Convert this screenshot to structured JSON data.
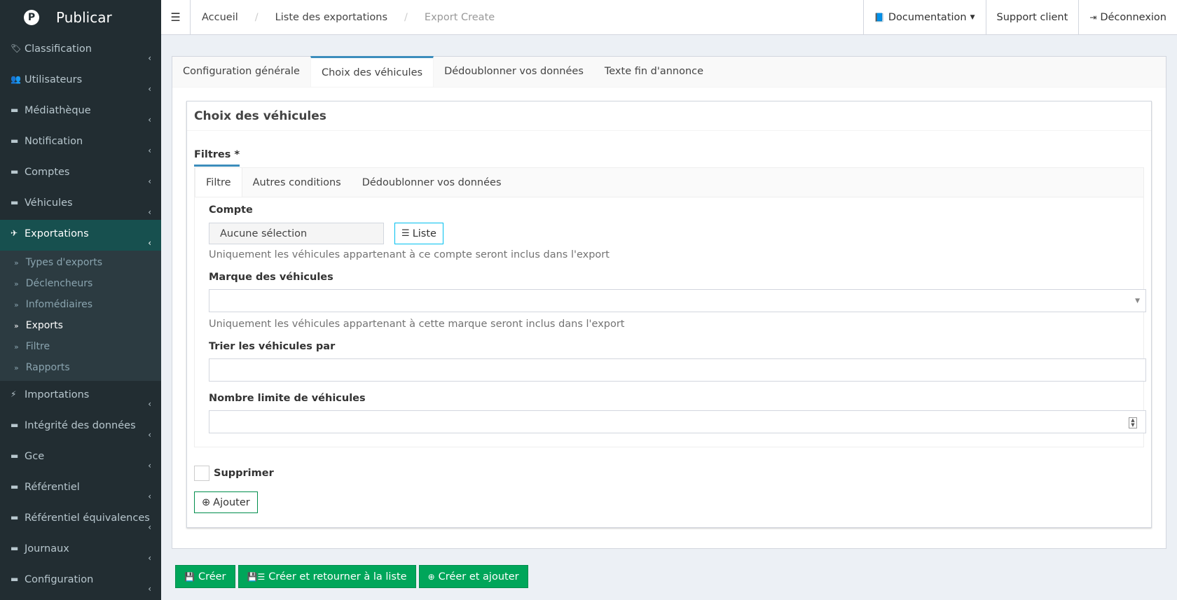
{
  "brand": {
    "logo": "P",
    "name": "Publicar"
  },
  "sidebar": {
    "items": [
      {
        "label": "Classification",
        "icon": "tags-icon",
        "glyph": "🏷"
      },
      {
        "label": "Utilisateurs",
        "icon": "users-icon",
        "glyph": "👥"
      },
      {
        "label": "Médiathèque",
        "icon": "folder-icon",
        "glyph": "▬"
      },
      {
        "label": "Notification",
        "icon": "folder-icon",
        "glyph": "▬"
      },
      {
        "label": "Comptes",
        "icon": "folder-icon",
        "glyph": "▬"
      },
      {
        "label": "Véhicules",
        "icon": "folder-icon",
        "glyph": "▬"
      },
      {
        "label": "Exportations",
        "icon": "paper-plane-icon",
        "glyph": "✈"
      }
    ],
    "submenu": [
      {
        "label": "Types d'exports"
      },
      {
        "label": "Déclencheurs"
      },
      {
        "label": "Infomédiaires"
      },
      {
        "label": "Exports"
      },
      {
        "label": "Filtre"
      },
      {
        "label": "Rapports"
      }
    ],
    "items_after": [
      {
        "label": "Importations",
        "icon": "bolt-icon",
        "glyph": "⚡"
      },
      {
        "label": "Intégrité des données",
        "icon": "folder-icon",
        "glyph": "▬"
      },
      {
        "label": "Gce",
        "icon": "folder-icon",
        "glyph": "▬"
      },
      {
        "label": "Référentiel",
        "icon": "folder-icon",
        "glyph": "▬"
      },
      {
        "label": "Référentiel équivalences",
        "icon": "folder-icon",
        "glyph": "▬"
      },
      {
        "label": "Journaux",
        "icon": "folder-icon",
        "glyph": "▬"
      },
      {
        "label": "Configuration",
        "icon": "folder-icon",
        "glyph": "▬"
      }
    ]
  },
  "topbar": {
    "breadcrumb": [
      "Accueil",
      "Liste des exportations",
      "Export Create"
    ],
    "documentation": "Documentation",
    "support": "Support client",
    "logout": "Déconnexion"
  },
  "tabs": [
    "Configuration générale",
    "Choix des véhicules",
    "Dédoublonner vos données",
    "Texte fin d'annonce"
  ],
  "box": {
    "title": "Choix des véhicules",
    "filters_title": "Filtres *",
    "inner_tabs": [
      "Filtre",
      "Autres conditions",
      "Dédoublonner vos données"
    ],
    "compte_label": "Compte",
    "compte_value": "Aucune sélection",
    "liste_button": "Liste",
    "compte_help": "Uniquement les véhicules appartenant à ce compte seront inclus dans l'export",
    "marque_label": "Marque des véhicules",
    "marque_help": "Uniquement les véhicules appartenant à cette marque seront inclus dans l'export",
    "trier_label": "Trier les véhicules par",
    "nombre_label": "Nombre limite de véhicules",
    "supprimer_label": "Supprimer",
    "ajouter_button": "Ajouter"
  },
  "footer": {
    "create": "Créer",
    "create_return": "Créer et retourner à la liste",
    "create_add": "Créer et ajouter"
  },
  "colors": {
    "sidebar": "#222d32",
    "active": "#17504f",
    "accent": "#3c8dbc",
    "success": "#00a65a"
  }
}
